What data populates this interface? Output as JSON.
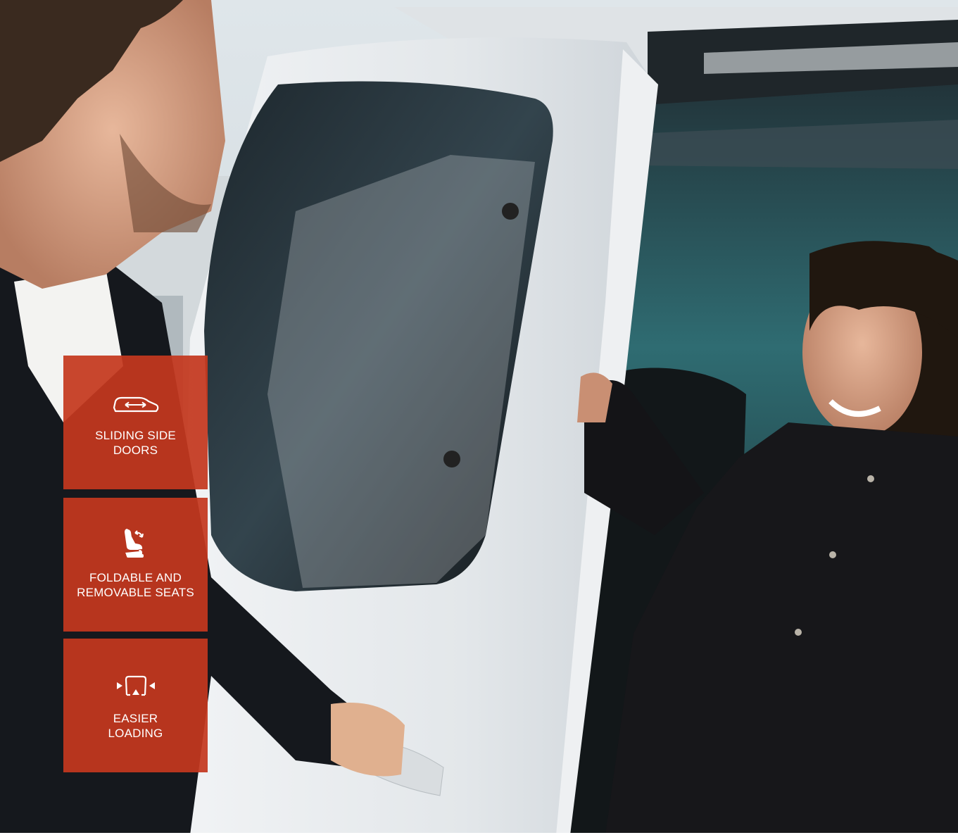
{
  "photo": {
    "subject": "man opening sliding side door of white van while woman sits inside"
  },
  "colors": {
    "tile_background": "#c4381e",
    "tile_text": "#ffffff",
    "van_body": "#e8ebee"
  },
  "features": [
    {
      "icon": "sliding-door-van-icon",
      "line1": "SLIDING SIDE",
      "line2": "DOORS"
    },
    {
      "icon": "folding-seat-icon",
      "line1": "FOLDABLE AND",
      "line2": "REMOVABLE SEATS"
    },
    {
      "icon": "loading-space-icon",
      "line1": "EASIER",
      "line2": "LOADING"
    }
  ]
}
